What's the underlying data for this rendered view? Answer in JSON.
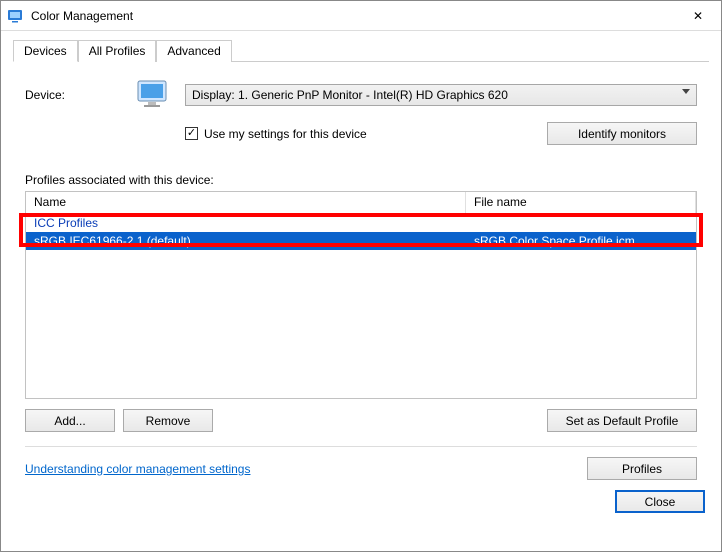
{
  "window": {
    "title": "Color Management",
    "close_glyph": "✕"
  },
  "tabs": {
    "devices": "Devices",
    "all_profiles": "All Profiles",
    "advanced": "Advanced"
  },
  "device": {
    "label": "Device:",
    "selected": "Display: 1. Generic PnP Monitor - Intel(R) HD Graphics 620",
    "use_settings_label": "Use my settings for this device",
    "use_settings_checked": true,
    "identify_btn": "Identify monitors"
  },
  "profiles": {
    "label": "Profiles associated with this device:",
    "columns": {
      "name": "Name",
      "file": "File name"
    },
    "group": "ICC Profiles",
    "rows": [
      {
        "name": "sRGB IEC61966-2.1 (default)",
        "file": "sRGB Color Space Profile.icm",
        "selected": true
      }
    ],
    "add_btn": "Add...",
    "remove_btn": "Remove",
    "set_default_btn": "Set as Default Profile"
  },
  "footer": {
    "link": "Understanding color management settings",
    "profiles_btn": "Profiles",
    "close_btn": "Close"
  },
  "icons": {
    "app_color": "#2a7bd6"
  }
}
